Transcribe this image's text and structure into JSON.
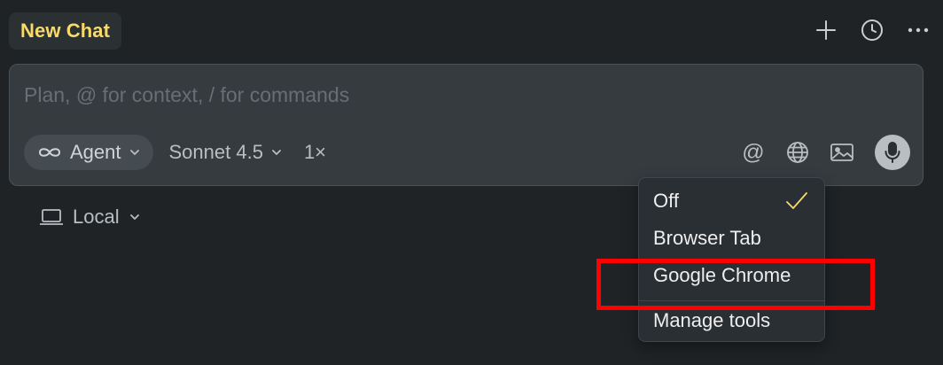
{
  "header": {
    "tab_title": "New Chat",
    "actions": [
      {
        "icon": "plus-icon"
      },
      {
        "icon": "history-icon"
      },
      {
        "icon": "more-icon"
      }
    ]
  },
  "composer": {
    "placeholder": "Plan, @ for context, / for commands",
    "value": "",
    "mode": {
      "icon": "infinity-icon",
      "label": "Agent"
    },
    "model": {
      "label": "Sonnet 4.5"
    },
    "multiplier": "1×",
    "tools": [
      {
        "icon": "at-icon",
        "glyph": "@"
      },
      {
        "icon": "globe-icon"
      },
      {
        "icon": "image-icon"
      },
      {
        "icon": "microphone-icon"
      }
    ]
  },
  "environment": {
    "icon": "laptop-icon",
    "label": "Local"
  },
  "menu": {
    "items": [
      {
        "label": "Off",
        "selected": true
      },
      {
        "label": "Browser Tab",
        "selected": false
      },
      {
        "label": "Google Chrome",
        "selected": false
      },
      {
        "label": "Manage tools",
        "selected": false
      }
    ]
  },
  "colors": {
    "background": "#1f2326",
    "accent_title": "#f7da6a",
    "check": "#f7da6a",
    "highlight": "#ff0000"
  }
}
